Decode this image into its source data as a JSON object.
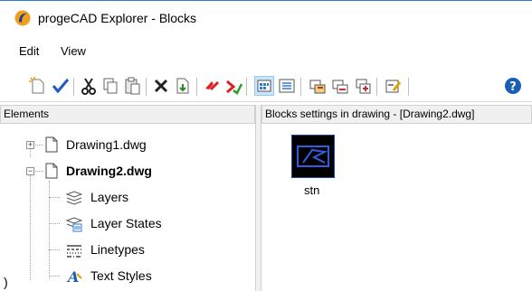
{
  "window": {
    "title": "progeCAD Explorer - Blocks",
    "app_icon": "progecad-logo-icon"
  },
  "menu": {
    "items": [
      {
        "label": "Edit"
      },
      {
        "label": "View"
      }
    ]
  },
  "toolbar": {
    "buttons": [
      "new-icon",
      "check-icon",
      "cut-icon",
      "copy-icon",
      "paste-icon",
      "delete-icon",
      "insert-icon",
      "undo-icon",
      "purge-icon",
      "large-icons-view-icon",
      "list-view-icon",
      "block-props-icon",
      "block-attr-icon",
      "block-export-icon",
      "wblock-icon",
      "help-icon"
    ]
  },
  "left_panel": {
    "header": "Elements",
    "tree": [
      {
        "label": "Drawing1.dwg",
        "expander": "+",
        "bold": false
      },
      {
        "label": "Drawing2.dwg",
        "expander": "−",
        "bold": true
      },
      {
        "label": "Layers",
        "icon": "layers-icon"
      },
      {
        "label": "Layer States",
        "icon": "layer-states-icon"
      },
      {
        "label": "Linetypes",
        "icon": "linetypes-icon"
      },
      {
        "label": "Text Styles",
        "icon": "text-styles-icon"
      }
    ]
  },
  "right_panel": {
    "header": "Blocks settings in drawing - [Drawing2.dwg]",
    "blocks": [
      {
        "name": "stn"
      }
    ]
  },
  "corner_text": ")",
  "colors": {
    "accent": "#2b7cd3",
    "selection": "#1f4aa8",
    "thumb_bg": "#000000"
  }
}
